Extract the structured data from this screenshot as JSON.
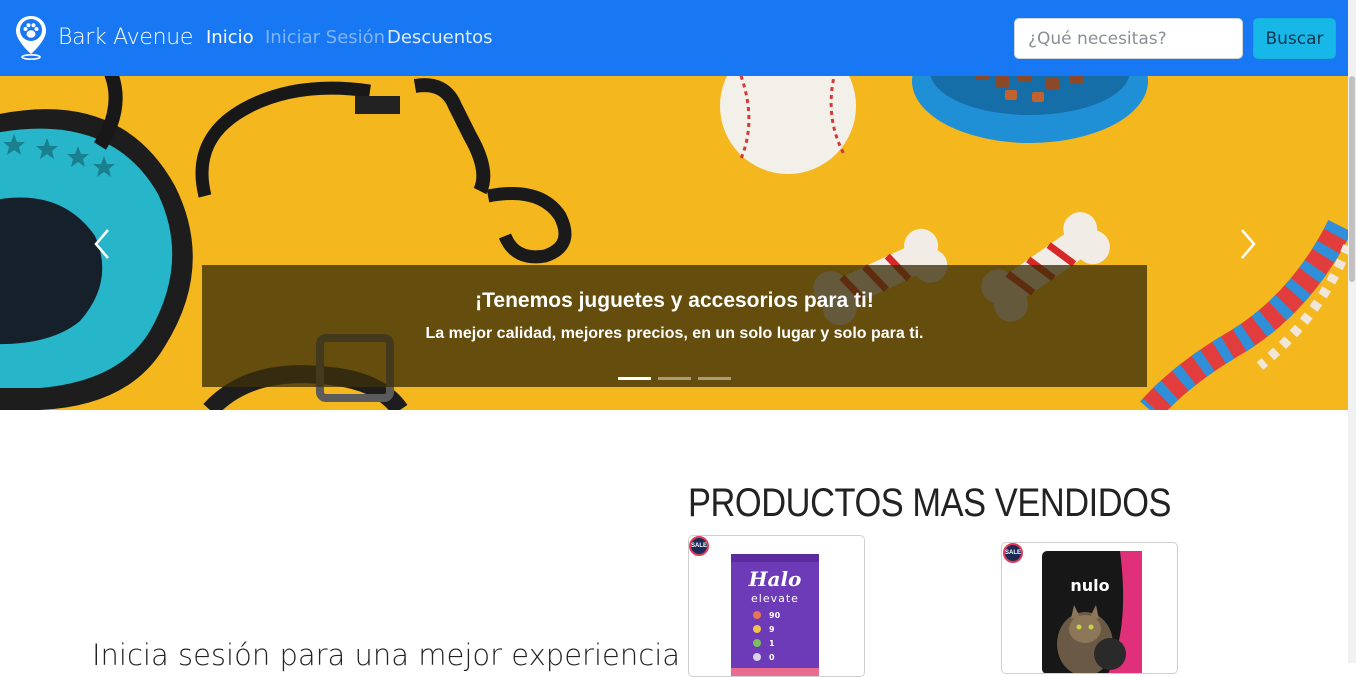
{
  "navbar": {
    "brand": "Bark Avenue",
    "links": [
      "Inicio",
      "Iniciar Sesión",
      "Descuentos"
    ],
    "search_placeholder": "¿Qué necesitas?",
    "search_button": "Buscar",
    "colors": {
      "background": "#1877f2",
      "button": "#17b8e8"
    }
  },
  "carousel": {
    "caption_title": "¡Tenemos juguetes y accesorios para ti!",
    "caption_text": "La mejor calidad, mejores precios, en un solo lugar y solo para ti.",
    "slides_count": 3,
    "active_slide": 1
  },
  "login_promo": "Inicia sesión para una mejor experiencia",
  "products_section": {
    "title": "PRODUCTOS MAS VENDIDOS",
    "products": [
      {
        "badge": "SALE",
        "brand": "Halo",
        "line": "elevate",
        "stats": [
          "90",
          "9",
          "1",
          "0"
        ]
      },
      {
        "badge": "SALE",
        "brand": "nulo"
      }
    ]
  }
}
